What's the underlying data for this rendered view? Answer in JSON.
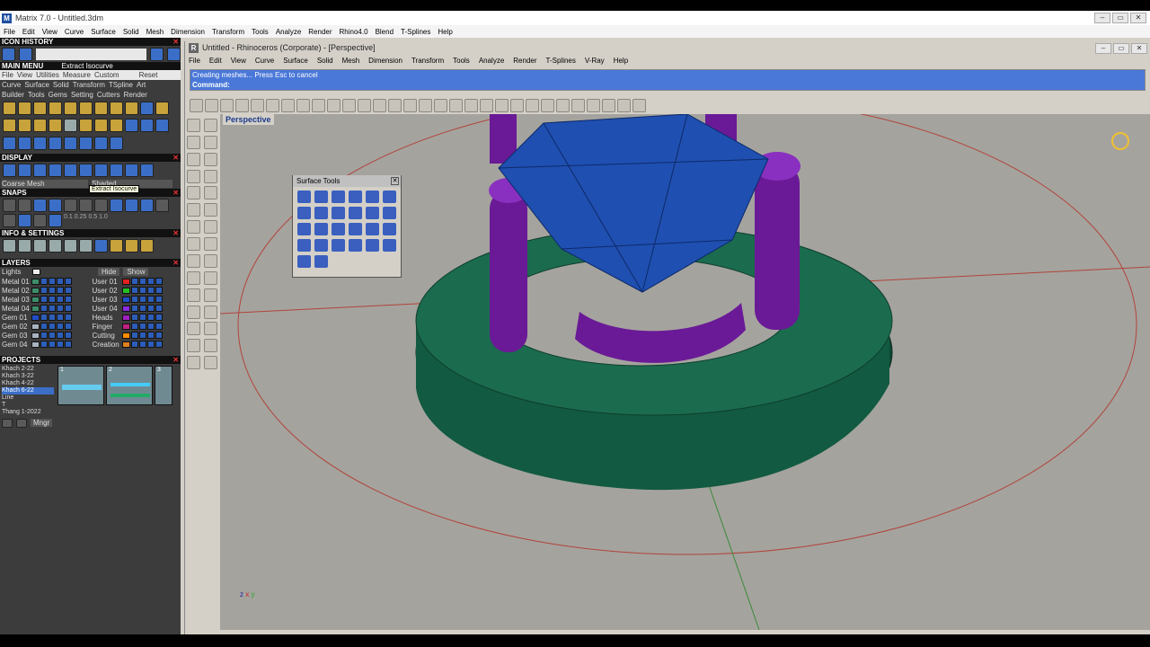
{
  "matrix": {
    "title": "Matrix 7.0 - Untitled.3dm",
    "menu": [
      "File",
      "Edit",
      "View",
      "Curve",
      "Surface",
      "Solid",
      "Mesh",
      "Dimension",
      "Transform",
      "Tools",
      "Analyze",
      "Render",
      "Rhino4.0",
      "Blend",
      "T-Splines",
      "Help"
    ]
  },
  "left": {
    "icon_history": "ICON HISTORY",
    "main_menu": "MAIN MENU",
    "main_menu_current": "Extract Isocurve",
    "submenu": [
      "File",
      "View",
      "Utilities",
      "Measure",
      "Custom"
    ],
    "reset": "Reset",
    "tabs_row1": [
      "Curve",
      "Surface",
      "Solid",
      "Transform",
      "TSpline",
      "Art"
    ],
    "tabs_row2": [
      "Builder",
      "Tools",
      "Gems",
      "Setting",
      "Cutters",
      "Render"
    ],
    "tooltip": "Extract Isocurve",
    "display": "DISPLAY",
    "display_mesh": "Coarse Mesh",
    "display_mode": "Shaded",
    "snaps": "SNAPS",
    "snap_values": [
      "0.1",
      "0.25",
      "0.5",
      "1.0"
    ],
    "info": "INFO & SETTINGS",
    "layers": "LAYERS",
    "lights": "Lights",
    "hide": "Hide",
    "show": "Show",
    "layers_left": [
      {
        "name": "Metal 01",
        "color": "#3c8e6a"
      },
      {
        "name": "Metal 02",
        "color": "#3c8e6a"
      },
      {
        "name": "Metal 03",
        "color": "#3c8e6a"
      },
      {
        "name": "Metal 04",
        "color": "#3c8e6a"
      },
      {
        "name": "Gem 01",
        "color": "#1f4fc8"
      },
      {
        "name": "Gem 02",
        "color": "#a8b4c0"
      },
      {
        "name": "Gem 03",
        "color": "#a8b4c0"
      },
      {
        "name": "Gem 04",
        "color": "#a8b4c0"
      }
    ],
    "layers_right": [
      {
        "name": "User 01",
        "color": "#e02020"
      },
      {
        "name": "User 02",
        "color": "#22c022"
      },
      {
        "name": "User 03",
        "color": "#1f4fc8"
      },
      {
        "name": "User 04",
        "color": "#8a2be2"
      },
      {
        "name": "Heads",
        "color": "#a020c0"
      },
      {
        "name": "Finger",
        "color": "#c02080"
      },
      {
        "name": "Cutting",
        "color": "#ff8c00"
      },
      {
        "name": "Creation",
        "color": "#e08020"
      }
    ],
    "projects": "PROJECTS",
    "project_list": [
      "Khach 2-22",
      "Khach 3-22",
      "Khach 4-22",
      "Khach 6-22",
      "Line",
      "T",
      "Thang 1-2022"
    ],
    "project_selected": "Khach 6-22",
    "thumb_nums": [
      "1",
      "2",
      "3"
    ],
    "mngr": "Mngr"
  },
  "rhino": {
    "title": "Untitled - Rhinoceros (Corporate) - [Perspective]",
    "menu": [
      "File",
      "Edit",
      "View",
      "Curve",
      "Surface",
      "Solid",
      "Mesh",
      "Dimension",
      "Transform",
      "Tools",
      "Analyze",
      "Render",
      "T-Splines",
      "V-Ray",
      "Help"
    ],
    "status": "Creating meshes... Press Esc to cancel",
    "command": "Command:",
    "viewport": "Perspective",
    "surface_tools": "Surface Tools",
    "axis": {
      "x": "x",
      "y": "y",
      "z": "z"
    }
  },
  "colors": {
    "ring": "#145a42",
    "prongs": "#6a1a96",
    "gem": "#1f4fb0",
    "cmd_bg": "#4a78d8",
    "viewport": "#a5a39e"
  }
}
